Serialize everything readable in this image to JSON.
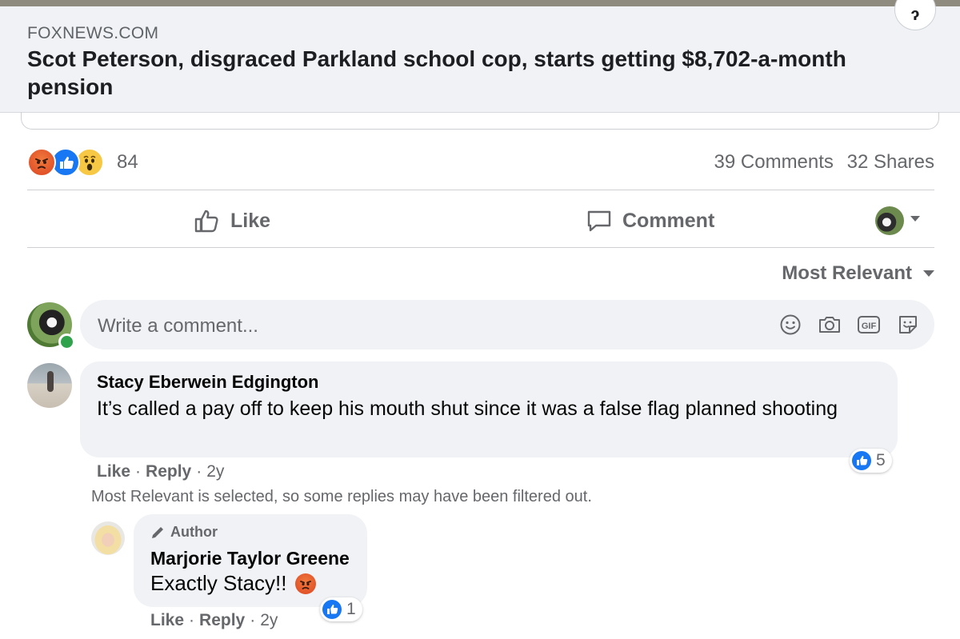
{
  "link_preview": {
    "domain": "FOXNEWS.COM",
    "headline": "Scot Peterson, disgraced Parkland school cop, starts getting $8,702-a-month pension",
    "corner_button_glyph": "ɂ"
  },
  "post_stats": {
    "reaction_icons": [
      "angry-reaction-icon",
      "like-reaction-icon",
      "wow-reaction-icon"
    ],
    "reaction_count": "84",
    "comments": "39 Comments",
    "shares": "32 Shares"
  },
  "post_actions": {
    "like_label": "Like",
    "comment_label": "Comment"
  },
  "sort": {
    "label": "Most Relevant"
  },
  "composer": {
    "placeholder": "Write a comment...",
    "icons": [
      "emoji-icon",
      "camera-icon",
      "gif-icon",
      "sticker-icon"
    ],
    "gif_label": "GIF"
  },
  "comments": [
    {
      "author": "Stacy Eberwein Edgington",
      "text": "It’s called a pay off to keep his mouth shut since it was a false flag planned shooting",
      "likes": "5",
      "like_label": "Like",
      "reply_label": "Reply",
      "age": "2y"
    }
  ],
  "filter_note": "Most Relevant is selected, so some replies may have been filtered out.",
  "replies": [
    {
      "badge": "Author",
      "author": "Marjorie Taylor Greene",
      "text": "Exactly Stacy!!",
      "emoji": "angry-emoji",
      "likes": "1",
      "like_label": "Like",
      "reply_label": "Reply",
      "age": "2y"
    }
  ],
  "colors": {
    "facebook_blue": "#1877f2",
    "secondary_text": "#65676b",
    "bubble_bg": "#f0f2f5",
    "online_green": "#31a24c"
  }
}
